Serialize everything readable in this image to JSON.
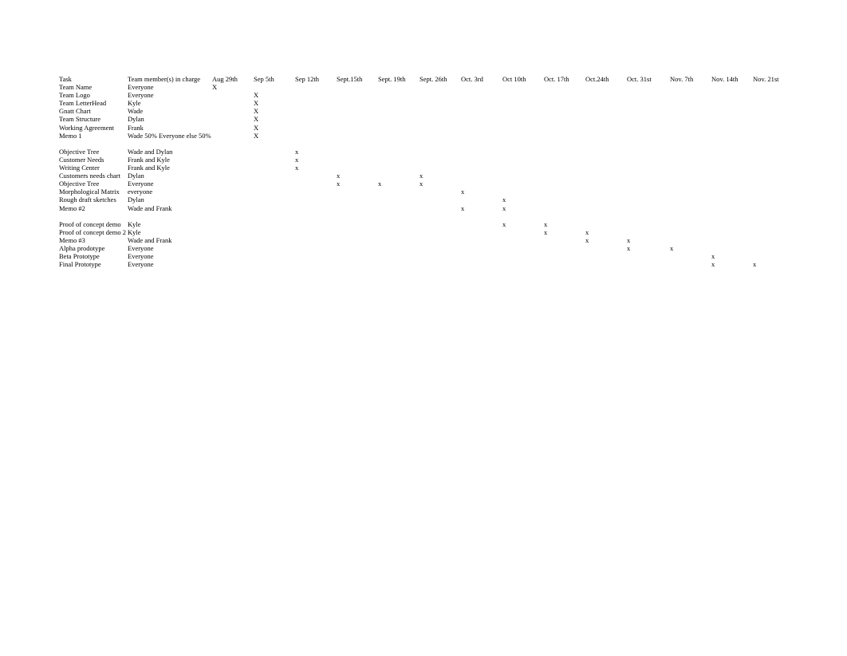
{
  "headers": {
    "task": "Task",
    "member": "Team member(s) in charge",
    "dates": [
      "Aug 29th",
      "Sep 5th",
      "Sep 12th",
      "Sept.15th",
      "Sept. 19th",
      "Sept. 26th",
      "Oct. 3rd",
      "Oct 10th",
      "Oct. 17th",
      "Oct.24th",
      "Oct. 31st",
      "Nov. 7th",
      "Nov. 14th",
      "Nov. 21st"
    ]
  },
  "rows": [
    {
      "task": "Team Name",
      "member": "Everyone",
      "marks": {
        "0": "X"
      }
    },
    {
      "task": "Team Logo",
      "member": "Everyone",
      "marks": {
        "1": "X"
      }
    },
    {
      "task": "Team LetterHead",
      "member": "Kyle",
      "marks": {
        "1": "X"
      }
    },
    {
      "task": "Gnatt Chart",
      "member": "Wade",
      "marks": {
        "1": "X"
      }
    },
    {
      "task": "Team Structure",
      "member": "Dylan",
      "marks": {
        "1": "X"
      }
    },
    {
      "task": "Working Agreement",
      "member": "Frank",
      "marks": {
        "1": "X"
      }
    },
    {
      "task": "Memo 1",
      "member": "Wade 50% Everyone else 50%",
      "marks": {
        "1": "X"
      }
    },
    {
      "blank": true
    },
    {
      "task": "Objective Tree",
      "member": "Wade and Dylan",
      "marks": {
        "2": "x"
      }
    },
    {
      "task": "Customer Needs",
      "member": "Frank and Kyle",
      "marks": {
        "2": "x"
      }
    },
    {
      "task": "Writing Center",
      "member": "Frank and Kyle",
      "marks": {
        "2": "x"
      }
    },
    {
      "task": "Customers needs chart",
      "member": "Dylan",
      "marks": {
        "3": "x",
        "5": "x"
      }
    },
    {
      "task": "Objective Tree",
      "member": "Everyone",
      "marks": {
        "3": "x",
        "4": "x",
        "5": "x"
      }
    },
    {
      "task": "Morphological Matrix",
      "member": "everyone",
      "marks": {
        "6": "x"
      }
    },
    {
      "task": "Rough draft sketches",
      "member": "Dylan",
      "marks": {
        "7": "x"
      }
    },
    {
      "task": "Memo #2",
      "member": "Wade and Frank",
      "marks": {
        "6": "x",
        "7": "x"
      }
    },
    {
      "blank": true
    },
    {
      "task": "Proof of concept demo",
      "member": "Kyle",
      "marks": {
        "7": "x",
        "8": "x"
      }
    },
    {
      "task": "Proof of concept demo 2",
      "member": "Kyle",
      "marks": {
        "8": "x",
        "9": "x"
      }
    },
    {
      "task": "Memo #3",
      "member": "Wade and Frank",
      "marks": {
        "9": "x",
        "10": "x"
      }
    },
    {
      "task": "Alpha prodotype",
      "member": "Everyone",
      "marks": {
        "10": "x",
        "11": "x"
      }
    },
    {
      "task": "Beta Prototype",
      "member": "Everyone",
      "marks": {
        "12": "x"
      }
    },
    {
      "task": "Final Prototype",
      "member": "Everyone",
      "marks": {
        "12": "x",
        "13": "x"
      }
    }
  ],
  "chart_data": {
    "type": "table",
    "title": "Gantt-style task assignment table",
    "columns": [
      "Task",
      "Team member(s) in charge",
      "Aug 29th",
      "Sep 5th",
      "Sep 12th",
      "Sept.15th",
      "Sept. 19th",
      "Sept. 26th",
      "Oct. 3rd",
      "Oct 10th",
      "Oct. 17th",
      "Oct.24th",
      "Oct. 31st",
      "Nov. 7th",
      "Nov. 14th",
      "Nov. 21st"
    ],
    "rows": [
      [
        "Team Name",
        "Everyone",
        "X",
        "",
        "",
        "",
        "",
        "",
        "",
        "",
        "",
        "",
        "",
        "",
        "",
        ""
      ],
      [
        "Team Logo",
        "Everyone",
        "",
        "X",
        "",
        "",
        "",
        "",
        "",
        "",
        "",
        "",
        "",
        "",
        "",
        ""
      ],
      [
        "Team LetterHead",
        "Kyle",
        "",
        "X",
        "",
        "",
        "",
        "",
        "",
        "",
        "",
        "",
        "",
        "",
        "",
        ""
      ],
      [
        "Gnatt Chart",
        "Wade",
        "",
        "X",
        "",
        "",
        "",
        "",
        "",
        "",
        "",
        "",
        "",
        "",
        "",
        ""
      ],
      [
        "Team Structure",
        "Dylan",
        "",
        "X",
        "",
        "",
        "",
        "",
        "",
        "",
        "",
        "",
        "",
        "",
        "",
        ""
      ],
      [
        "Working Agreement",
        "Frank",
        "",
        "X",
        "",
        "",
        "",
        "",
        "",
        "",
        "",
        "",
        "",
        "",
        "",
        ""
      ],
      [
        "Memo 1",
        "Wade 50% Everyone else 50%",
        "",
        "X",
        "",
        "",
        "",
        "",
        "",
        "",
        "",
        "",
        "",
        "",
        "",
        ""
      ],
      [
        "Objective Tree",
        "Wade and Dylan",
        "",
        "",
        "x",
        "",
        "",
        "",
        "",
        "",
        "",
        "",
        "",
        "",
        "",
        ""
      ],
      [
        "Customer Needs",
        "Frank and Kyle",
        "",
        "",
        "x",
        "",
        "",
        "",
        "",
        "",
        "",
        "",
        "",
        "",
        "",
        ""
      ],
      [
        "Writing Center",
        "Frank and Kyle",
        "",
        "",
        "x",
        "",
        "",
        "",
        "",
        "",
        "",
        "",
        "",
        "",
        "",
        ""
      ],
      [
        "Customers needs chart",
        "Dylan",
        "",
        "",
        "",
        "x",
        "",
        "x",
        "",
        "",
        "",
        "",
        "",
        "",
        "",
        ""
      ],
      [
        "Objective Tree",
        "Everyone",
        "",
        "",
        "",
        "x",
        "x",
        "x",
        "",
        "",
        "",
        "",
        "",
        "",
        "",
        ""
      ],
      [
        "Morphological Matrix",
        "everyone",
        "",
        "",
        "",
        "",
        "",
        "",
        "x",
        "",
        "",
        "",
        "",
        "",
        "",
        ""
      ],
      [
        "Rough draft sketches",
        "Dylan",
        "",
        "",
        "",
        "",
        "",
        "",
        "",
        "x",
        "",
        "",
        "",
        "",
        "",
        ""
      ],
      [
        "Memo #2",
        "Wade and Frank",
        "",
        "",
        "",
        "",
        "",
        "",
        "x",
        "x",
        "",
        "",
        "",
        "",
        "",
        ""
      ],
      [
        "Proof of concept demo",
        "Kyle",
        "",
        "",
        "",
        "",
        "",
        "",
        "",
        "x",
        "x",
        "",
        "",
        "",
        "",
        ""
      ],
      [
        "Proof of concept demo 2",
        "Kyle",
        "",
        "",
        "",
        "",
        "",
        "",
        "",
        "",
        "x",
        "x",
        "",
        "",
        "",
        ""
      ],
      [
        "Memo #3",
        "Wade and Frank",
        "",
        "",
        "",
        "",
        "",
        "",
        "",
        "",
        "",
        "x",
        "x",
        "",
        "",
        ""
      ],
      [
        "Alpha prodotype",
        "Everyone",
        "",
        "",
        "",
        "",
        "",
        "",
        "",
        "",
        "",
        "",
        "x",
        "x",
        "",
        ""
      ],
      [
        "Beta Prototype",
        "Everyone",
        "",
        "",
        "",
        "",
        "",
        "",
        "",
        "",
        "",
        "",
        "",
        "",
        "x",
        ""
      ],
      [
        "Final Prototype",
        "Everyone",
        "",
        "",
        "",
        "",
        "",
        "",
        "",
        "",
        "",
        "",
        "",
        "",
        "x",
        "x"
      ]
    ]
  }
}
